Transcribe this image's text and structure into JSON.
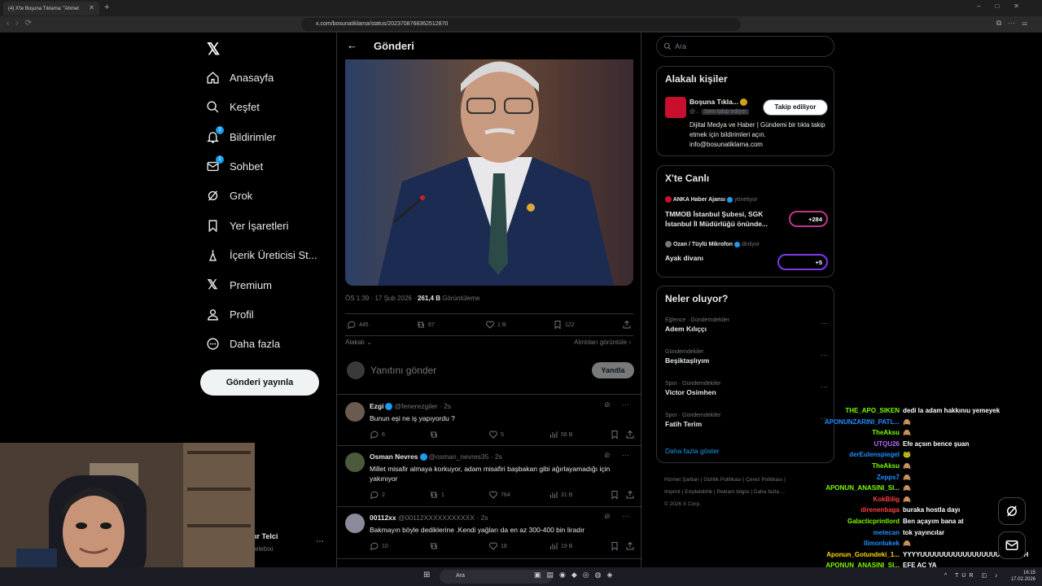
{
  "browser": {
    "tab_title": "(4) X'te Boşuna Tıklama: \"Ahmet",
    "url": "x.com/bosunatiklama/status/2023708768362512870"
  },
  "nav": {
    "items": [
      {
        "label": "Anasayfa",
        "icon": "home-icon"
      },
      {
        "label": "Keşfet",
        "icon": "search-icon"
      },
      {
        "label": "Bildirimler",
        "icon": "bell-icon",
        "badge": "2"
      },
      {
        "label": "Sohbet",
        "icon": "mail-icon",
        "badge": "2"
      },
      {
        "label": "Grok",
        "icon": "grok-icon"
      },
      {
        "label": "Yer İşaretleri",
        "icon": "bookmark-icon"
      },
      {
        "label": "İçerik Üreticisi St...",
        "icon": "creator-icon"
      },
      {
        "label": "Premium",
        "icon": "x-logo-icon"
      },
      {
        "label": "Profil",
        "icon": "person-icon"
      },
      {
        "label": "Daha fazla",
        "icon": "more-circle-icon"
      }
    ],
    "post_button": "Gönderi yayınla",
    "account_name": "ır Telci",
    "account_handle": "elebixi"
  },
  "post": {
    "header_title": "Gönderi",
    "meta_time": "ÖS 1:39 · 17 Şub 2026 · ",
    "meta_views": "261,4 B",
    "meta_views_label": " Görüntüleme",
    "replies": "445",
    "reposts": "67",
    "likes": "1 B",
    "bookmarks": "122",
    "sort_label": "Alakalı",
    "quotes_label": "Alıntıları görüntüle",
    "reply_placeholder": "Yanıtını gönder",
    "reply_button": "Yanıtla"
  },
  "comments": [
    {
      "name": "Ezgi",
      "handle": "@fenerezgiler · 2s",
      "text": "Bunun eşi ne iş yapıyordu ?",
      "replies": "6",
      "reposts": "",
      "likes": "5",
      "views": "56 B"
    },
    {
      "name": "Osman Nevres",
      "handle": "@osman_nevres35 · 2s",
      "text": "Millet misafir almaya korkuyor, adam misafiri başbakan gibi ağırlayamadığı için yakınıyor",
      "replies": "2",
      "reposts": "1",
      "likes": "764",
      "views": "31 B"
    },
    {
      "name": "00112xx",
      "handle": "@00112XXXXXXXXXXX · 2s",
      "text": "Bakmayın böyle dediklerine .Kendi yağları da en az 300-400 bin liradır",
      "replies": "10",
      "reposts": "",
      "likes": "18",
      "views": "19 B"
    }
  ],
  "sidebar": {
    "search_placeholder": "Ara",
    "related": {
      "title": "Alakalı kişiler",
      "name": "Boşuna Tıkla...",
      "handle": "@...",
      "follows_you": "Seni takip ediyor",
      "follow_button": "Takip ediliyor",
      "bio": "Dijital Medya ve Haber | Gündemi bir tıkla takip etmek için bildirimleri açın. info@bosunatiklama.com"
    },
    "live": {
      "title": "X'te Canlı",
      "items": [
        {
          "host": "ANKA Haber Ajansı",
          "role": "yönetiyor",
          "title": "TMMOB İstanbul Şubesi, SGK İstanbul İl Müdürlüğü önünde...",
          "count": "+284"
        },
        {
          "host": "Ozan / Tüylü Mikrofon",
          "role": "dinliyor",
          "title": "Ayak divanı",
          "count": "+5"
        }
      ]
    },
    "trends": {
      "title": "Neler oluyor?",
      "items": [
        {
          "category": "Eğlence · Gündemdekiler",
          "name": "Adem Kılıççı"
        },
        {
          "category": "Gündemdekiler",
          "name": "Beşiktaşlıyım"
        },
        {
          "category": "Spor · Gündemdekiler",
          "name": "Victor Osimhen"
        },
        {
          "category": "Spor · Gündemdekiler",
          "name": "Fatih Terim"
        }
      ],
      "show_more": "Daha fazla göster"
    },
    "footer": {
      "l1": "Hizmet Şartları",
      "l2": "Gizlilik Politikası",
      "l3": "Çerez Politikası",
      "l4": "Imprint",
      "l5": "Erişilebilirlik",
      "l6": "Reklam bilgisi",
      "l7": "Daha fazla ...",
      "copyright": "© 2026 X Corp."
    }
  },
  "chat": [
    {
      "user": "THE_APO_SIKEN",
      "color": "#7cfc00",
      "msg": "dedi la adam hakkınıu yemeyek"
    },
    {
      "user": "APONUNZARINI_PATL...",
      "color": "#1e90ff",
      "msg": "🙈"
    },
    {
      "user": "TheAksu",
      "color": "#7cfc00",
      "msg": "🙈"
    },
    {
      "user": "UTQU26",
      "color": "#b36bff",
      "msg": "Efe açsın bence şuan"
    },
    {
      "user": "derEulenspiegel",
      "color": "#1e90ff",
      "msg": "🐸"
    },
    {
      "user": "TheAksu",
      "color": "#7cfc00",
      "msg": "🙈"
    },
    {
      "user": "Zepps7",
      "color": "#1e90ff",
      "msg": "🙈"
    },
    {
      "user": "APONUN_ANASINI_SI...",
      "color": "#7cfc00",
      "msg": "🙈"
    },
    {
      "user": "KokBilig",
      "color": "#ff4040",
      "msg": "🙈"
    },
    {
      "user": "direnenbaga",
      "color": "#ff4040",
      "msg": "buraka hostla dayı"
    },
    {
      "user": "Galacticprintlord",
      "color": "#7cfc00",
      "msg": "Ben açayım bana at"
    },
    {
      "user": "metecan",
      "color": "#1e90ff",
      "msg": "tok yayıncılar"
    },
    {
      "user": "llimonlukek",
      "color": "#1e90ff",
      "msg": "🙈"
    },
    {
      "user": "Aponun_Gotundeki_1...",
      "color": "#ffd700",
      "msg": "YYYYUUUUUUUUUUUUUUUUUUHHHHH"
    },
    {
      "user": "APONUN_ANASINI_SI...",
      "color": "#7cfc00",
      "msg": "EFE AC YA"
    }
  ],
  "taskbar": {
    "search": "Ara",
    "lang": "TUR",
    "time": "16:15",
    "date": "17.02.2026"
  },
  "colors": {
    "accent": "#1d9bf0",
    "bg": "#000000",
    "border": "#2f3336",
    "muted": "#71767b"
  }
}
